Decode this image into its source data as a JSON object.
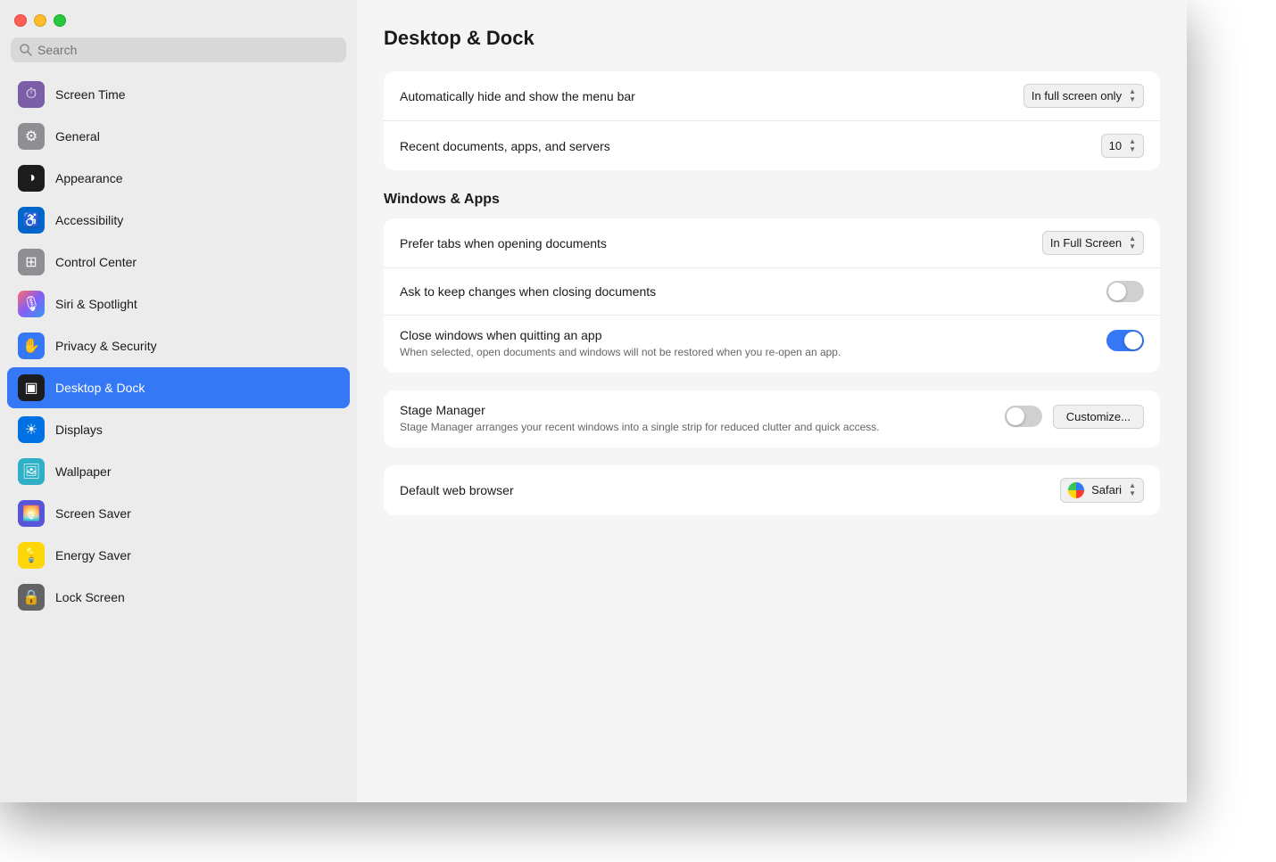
{
  "window": {
    "title": "Desktop & Dock"
  },
  "titlebar": {
    "close_label": "close",
    "minimize_label": "minimize",
    "maximize_label": "maximize"
  },
  "search": {
    "placeholder": "Search"
  },
  "sidebar": {
    "items": [
      {
        "id": "screen-time",
        "label": "Screen Time",
        "icon": "⏱",
        "icon_class": "icon-screen-time"
      },
      {
        "id": "general",
        "label": "General",
        "icon": "⚙",
        "icon_class": "icon-general"
      },
      {
        "id": "appearance",
        "label": "Appearance",
        "icon": "◑",
        "icon_class": "icon-appearance"
      },
      {
        "id": "accessibility",
        "label": "Accessibility",
        "icon": "♿",
        "icon_class": "icon-accessibility"
      },
      {
        "id": "control-center",
        "label": "Control Center",
        "icon": "⊞",
        "icon_class": "icon-control-center"
      },
      {
        "id": "siri",
        "label": "Siri & Spotlight",
        "icon": "🎙",
        "icon_class": "icon-siri"
      },
      {
        "id": "privacy",
        "label": "Privacy & Security",
        "icon": "✋",
        "icon_class": "icon-privacy"
      },
      {
        "id": "desktop-dock",
        "label": "Desktop & Dock",
        "icon": "▣",
        "icon_class": "icon-desktop-dock",
        "active": true
      },
      {
        "id": "displays",
        "label": "Displays",
        "icon": "☀",
        "icon_class": "icon-displays"
      },
      {
        "id": "wallpaper",
        "label": "Wallpaper",
        "icon": "🖼",
        "icon_class": "icon-wallpaper"
      },
      {
        "id": "screen-saver",
        "label": "Screen Saver",
        "icon": "🌅",
        "icon_class": "icon-screen-saver"
      },
      {
        "id": "energy",
        "label": "Energy Saver",
        "icon": "💡",
        "icon_class": "icon-energy"
      },
      {
        "id": "lock",
        "label": "Lock Screen",
        "icon": "🔒",
        "icon_class": "icon-lock"
      }
    ]
  },
  "main": {
    "title": "Desktop & Dock",
    "settings_group1": {
      "rows": [
        {
          "id": "menu-bar",
          "label": "Automatically hide and show the menu bar",
          "control_type": "dropdown",
          "value": "In full screen only"
        },
        {
          "id": "recent-docs",
          "label": "Recent documents, apps, and servers",
          "control_type": "stepper",
          "value": "10"
        }
      ]
    },
    "section_windows": "Windows & Apps",
    "settings_group2": {
      "rows": [
        {
          "id": "prefer-tabs",
          "label": "Prefer tabs when opening documents",
          "control_type": "dropdown",
          "value": "In Full Screen"
        },
        {
          "id": "keep-changes",
          "label": "Ask to keep changes when closing documents",
          "control_type": "toggle",
          "state": "off"
        },
        {
          "id": "close-windows",
          "label": "Close windows when quitting an app",
          "sublabel": "When selected, open documents and windows will not be restored when you re-open an app.",
          "control_type": "toggle",
          "state": "on"
        }
      ]
    },
    "settings_group3": {
      "rows": [
        {
          "id": "stage-manager",
          "label": "Stage Manager",
          "sublabel": "Stage Manager arranges your recent windows into a single strip for reduced clutter and quick access.",
          "control_type": "toggle_customize",
          "state": "off",
          "customize_label": "Customize..."
        }
      ]
    },
    "settings_group4": {
      "rows": [
        {
          "id": "default-browser",
          "label": "Default web browser",
          "control_type": "browser_dropdown",
          "value": "Safari"
        }
      ]
    }
  }
}
